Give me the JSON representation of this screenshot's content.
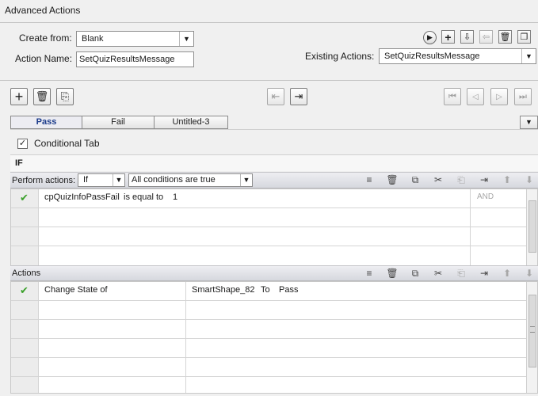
{
  "window": {
    "title": "Advanced Actions"
  },
  "form": {
    "create_from_label": "Create from:",
    "create_from_value": "Blank",
    "action_name_label": "Action Name:",
    "action_name_value": "SetQuizResultsMessage",
    "existing_actions_label": "Existing Actions:",
    "existing_actions_value": "SetQuizResultsMessage"
  },
  "tabs": [
    {
      "label": "Pass",
      "active": true
    },
    {
      "label": "Fail",
      "active": false
    },
    {
      "label": "Untitled-3",
      "active": false
    }
  ],
  "conditional": {
    "label": "Conditional Tab",
    "checked": true
  },
  "if_section": {
    "header": "IF",
    "perform_label": "Perform actions:",
    "perform_value": "If",
    "conditions_value": "All conditions are true",
    "rows": [
      {
        "checked": true,
        "variable": "cpQuizInfoPassFail",
        "operator": "is equal to",
        "value": "1",
        "logic": "AND"
      }
    ]
  },
  "actions_section": {
    "header": "Actions",
    "rows": [
      {
        "checked": true,
        "action": "Change State of",
        "target": "SmartShape_82",
        "to_label": "To",
        "state": "Pass"
      }
    ]
  },
  "icons": {
    "play": "play-icon",
    "add": "plus-icon",
    "save": "save-icon",
    "import": "import-icon",
    "delete": "trash-icon",
    "duplicate": "duplicate-icon",
    "arrow_down": "chevron-down-icon"
  }
}
